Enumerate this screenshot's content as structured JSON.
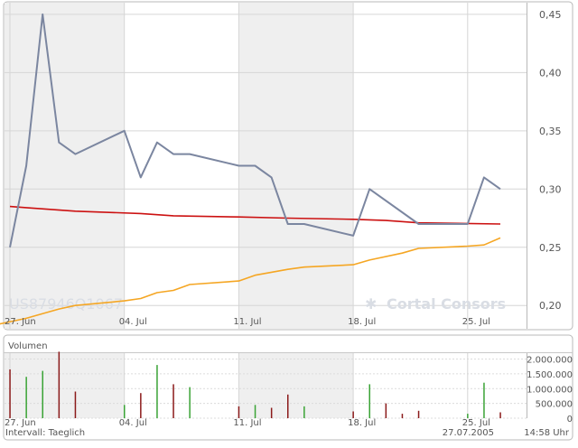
{
  "chart_data": [
    {
      "type": "line",
      "x_labels": [
        "27. Jun",
        "04. Jul",
        "11. Jul",
        "18. Jul",
        "25. Jul"
      ],
      "y_ticks": [
        "0,45",
        "0,40",
        "0,35",
        "0,30",
        "0,25",
        "0,20"
      ],
      "ylim": [
        0.18,
        0.46
      ],
      "grid": true,
      "watermark_isin": "US87946Q1067",
      "watermark_brand": "Cortal Consors",
      "series": [
        {
          "kind": "price",
          "color": "#7b86a0",
          "points": [
            [
              "2005-06-27",
              0.25
            ],
            [
              "2005-06-28",
              0.32
            ],
            [
              "2005-06-29",
              0.45
            ],
            [
              "2005-06-30",
              0.34
            ],
            [
              "2005-07-01",
              0.33
            ],
            [
              "2005-07-04",
              0.35
            ],
            [
              "2005-07-05",
              0.31
            ],
            [
              "2005-07-06",
              0.34
            ],
            [
              "2005-07-07",
              0.33
            ],
            [
              "2005-07-08",
              0.33
            ],
            [
              "2005-07-11",
              0.32
            ],
            [
              "2005-07-12",
              0.32
            ],
            [
              "2005-07-13",
              0.31
            ],
            [
              "2005-07-14",
              0.27
            ],
            [
              "2005-07-15",
              0.27
            ],
            [
              "2005-07-18",
              0.26
            ],
            [
              "2005-07-19",
              0.3
            ],
            [
              "2005-07-22",
              0.27
            ],
            [
              "2005-07-25",
              0.27
            ],
            [
              "2005-07-26",
              0.31
            ],
            [
              "2005-07-27",
              0.3
            ]
          ]
        },
        {
          "kind": "average-long",
          "color": "#cc1111",
          "points": [
            [
              "2005-06-27",
              0.285
            ],
            [
              "2005-06-28",
              0.284
            ],
            [
              "2005-07-01",
              0.281
            ],
            [
              "2005-07-05",
              0.279
            ],
            [
              "2005-07-07",
              0.277
            ],
            [
              "2005-07-11",
              0.276
            ],
            [
              "2005-07-14",
              0.275
            ],
            [
              "2005-07-18",
              0.274
            ],
            [
              "2005-07-20",
              0.273
            ],
            [
              "2005-07-22",
              0.271
            ],
            [
              "2005-07-27",
              0.27
            ]
          ]
        },
        {
          "kind": "average-short",
          "color": "#f5a623",
          "points": [
            [
              "2005-06-26",
              0.183
            ],
            [
              "2005-06-28",
              0.189
            ],
            [
              "2005-06-30",
              0.197
            ],
            [
              "2005-07-01",
              0.2
            ],
            [
              "2005-07-04",
              0.204
            ],
            [
              "2005-07-05",
              0.206
            ],
            [
              "2005-07-06",
              0.211
            ],
            [
              "2005-07-07",
              0.213
            ],
            [
              "2005-07-08",
              0.218
            ],
            [
              "2005-07-11",
              0.221
            ],
            [
              "2005-07-12",
              0.226
            ],
            [
              "2005-07-14",
              0.231
            ],
            [
              "2005-07-15",
              0.233
            ],
            [
              "2005-07-18",
              0.235
            ],
            [
              "2005-07-19",
              0.239
            ],
            [
              "2005-07-21",
              0.245
            ],
            [
              "2005-07-22",
              0.249
            ],
            [
              "2005-07-25",
              0.251
            ],
            [
              "2005-07-26",
              0.252
            ],
            [
              "2005-07-27",
              0.258
            ]
          ]
        }
      ]
    },
    {
      "type": "bar",
      "title": "Volumen",
      "x_labels": [
        "27. Jun",
        "04. Jul",
        "11. Jul",
        "18. Jul",
        "25. Jul"
      ],
      "y_ticks": [
        "2.000.000",
        "1.500.000",
        "1.000.000",
        "500.000",
        "0"
      ],
      "ylim": [
        0,
        2200000
      ],
      "up_color": "#3aa335",
      "down_color": "#8b1a1a",
      "bars": [
        [
          "2005-06-27",
          1650000,
          "down"
        ],
        [
          "2005-06-28",
          1400000,
          "up"
        ],
        [
          "2005-06-29",
          1600000,
          "up"
        ],
        [
          "2005-06-30",
          2250000,
          "down"
        ],
        [
          "2005-07-01",
          900000,
          "down"
        ],
        [
          "2005-07-04",
          450000,
          "up"
        ],
        [
          "2005-07-05",
          850000,
          "down"
        ],
        [
          "2005-07-06",
          1800000,
          "up"
        ],
        [
          "2005-07-07",
          1150000,
          "down"
        ],
        [
          "2005-07-08",
          1050000,
          "up"
        ],
        [
          "2005-07-11",
          400000,
          "down"
        ],
        [
          "2005-07-12",
          450000,
          "up"
        ],
        [
          "2005-07-13",
          350000,
          "down"
        ],
        [
          "2005-07-14",
          800000,
          "down"
        ],
        [
          "2005-07-15",
          400000,
          "up"
        ],
        [
          "2005-07-18",
          230000,
          "down"
        ],
        [
          "2005-07-19",
          1150000,
          "up"
        ],
        [
          "2005-07-20",
          500000,
          "down"
        ],
        [
          "2005-07-21",
          150000,
          "down"
        ],
        [
          "2005-07-22",
          250000,
          "down"
        ],
        [
          "2005-07-25",
          150000,
          "up"
        ],
        [
          "2005-07-26",
          1200000,
          "up"
        ],
        [
          "2005-07-27",
          200000,
          "down"
        ]
      ]
    }
  ],
  "footer": {
    "interval": "Intervall: Taeglich",
    "date": "27.07.2005",
    "time": "14:58 Uhr"
  }
}
